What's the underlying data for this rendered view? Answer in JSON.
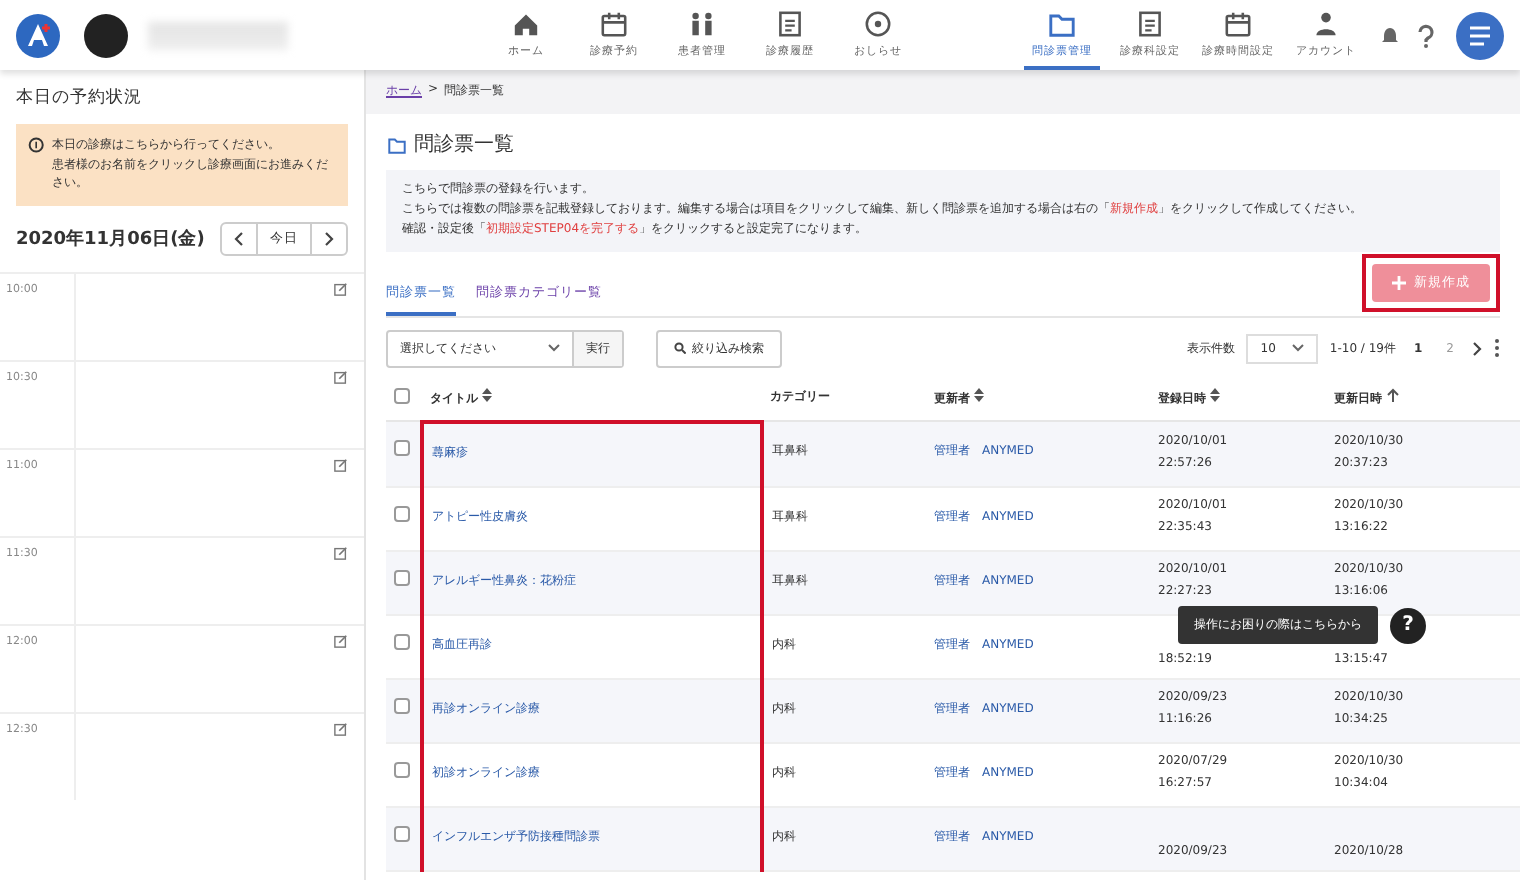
{
  "header": {
    "nav": [
      {
        "label": "ホーム",
        "selected": false
      },
      {
        "label": "診療予約",
        "selected": false
      },
      {
        "label": "患者管理",
        "selected": false
      },
      {
        "label": "診療履歴",
        "selected": false
      },
      {
        "label": "おしらせ",
        "selected": false
      }
    ],
    "nav_right": [
      {
        "label": "問診票管理",
        "selected": true
      },
      {
        "label": "診療科設定",
        "selected": false
      },
      {
        "label": "診療時間設定",
        "selected": false
      },
      {
        "label": "アカウント",
        "selected": false
      }
    ]
  },
  "sidebar": {
    "title": "本日の予約状況",
    "notice": [
      "本日の診療はこちらから行ってください。",
      "患者様のお名前をクリックし診療画面にお進みください。"
    ],
    "date": "2020年11月06日(金)",
    "today_button": "今日",
    "slots": [
      "10:00",
      "10:30",
      "11:00",
      "11:30",
      "12:00",
      "12:30"
    ]
  },
  "breadcrumb": {
    "home": "ホーム",
    "separator": ">",
    "current": "問診票一覧"
  },
  "page_title": "問診票一覧",
  "info": [
    "こちらで問診票の登録を行います。",
    "こちらでは複数の問診票を記載登録しております。編集する場合は項目をクリックして編集、新しく問診票を追加する場合は右の「**新規作成**」をクリックして作成してください。",
    "確認・設定後「**初期設定STEP04を完了する**」をクリックすると設定完了になります。"
  ],
  "tabs": [
    {
      "label": "問診票一覧",
      "selected": true
    },
    {
      "label": "問診票カテゴリー覧",
      "selected": false
    }
  ],
  "new_button": {
    "label": "新規作成",
    "outlined": true
  },
  "toolbar": {
    "select_placeholder": "選択してください",
    "run": "実行",
    "filter": "絞り込み検索",
    "per_page_label": "表示件数",
    "per_page": "10",
    "range": "1-10 / 19件",
    "pages": [
      {
        "label": "1",
        "selected": true
      },
      {
        "label": "2",
        "selected": false
      }
    ]
  },
  "table": {
    "all_checked": false,
    "columns": [
      {
        "label": "タイトル",
        "sortable": true,
        "sorted": false,
        "outlined": true
      },
      {
        "label": "カテゴリー",
        "sortable": false,
        "sorted": false,
        "outlined": false
      },
      {
        "label": "更新者",
        "sortable": true,
        "sorted": false,
        "outlined": false
      },
      {
        "label": "登録日時",
        "sortable": true,
        "sorted": false,
        "outlined": false
      },
      {
        "label": "更新日時",
        "sortable": false,
        "sorted": true,
        "outlined": false
      }
    ],
    "rows": [
      {
        "checked": false,
        "title": "蕁麻疹",
        "category": "耳鼻科",
        "updater": "管理者　ANYMED",
        "registered": [
          "2020/10/01",
          "22:57:26"
        ],
        "updated": [
          "2020/10/30",
          "20:37:23"
        ]
      },
      {
        "checked": false,
        "title": "アトピー性皮膚炎",
        "category": "耳鼻科",
        "updater": "管理者　ANYMED",
        "registered": [
          "2020/10/01",
          "22:35:43"
        ],
        "updated": [
          "2020/10/30",
          "13:16:22"
        ]
      },
      {
        "checked": false,
        "title": "アレルギー性鼻炎：花粉症",
        "category": "耳鼻科",
        "updater": "管理者　ANYMED",
        "registered": [
          "2020/10/01",
          "22:27:23"
        ],
        "updated": [
          "2020/10/30",
          "13:16:06"
        ]
      },
      {
        "checked": false,
        "title": "高血圧再診",
        "category": "内科",
        "updater": "管理者　ANYMED",
        "registered": [
          "18:52:19"
        ],
        "updated": [
          "13:15:47"
        ]
      },
      {
        "checked": false,
        "title": "再診オンライン診療",
        "category": "内科",
        "updater": "管理者　ANYMED",
        "registered": [
          "2020/09/23",
          "11:16:26"
        ],
        "updated": [
          "2020/10/30",
          "10:34:25"
        ]
      },
      {
        "checked": false,
        "title": "初診オンライン診療",
        "category": "内科",
        "updater": "管理者　ANYMED",
        "registered": [
          "2020/07/29",
          "16:27:57"
        ],
        "updated": [
          "2020/10/30",
          "10:34:04"
        ]
      },
      {
        "checked": false,
        "title": "インフルエンザ予防接種問診票",
        "category": "内科",
        "updater": "管理者　ANYMED",
        "registered": [
          "2020/09/23"
        ],
        "updated": [
          "2020/10/28"
        ]
      }
    ]
  },
  "help": {
    "tooltip": "操作にお困りの際はこちらから",
    "icon": "?"
  }
}
